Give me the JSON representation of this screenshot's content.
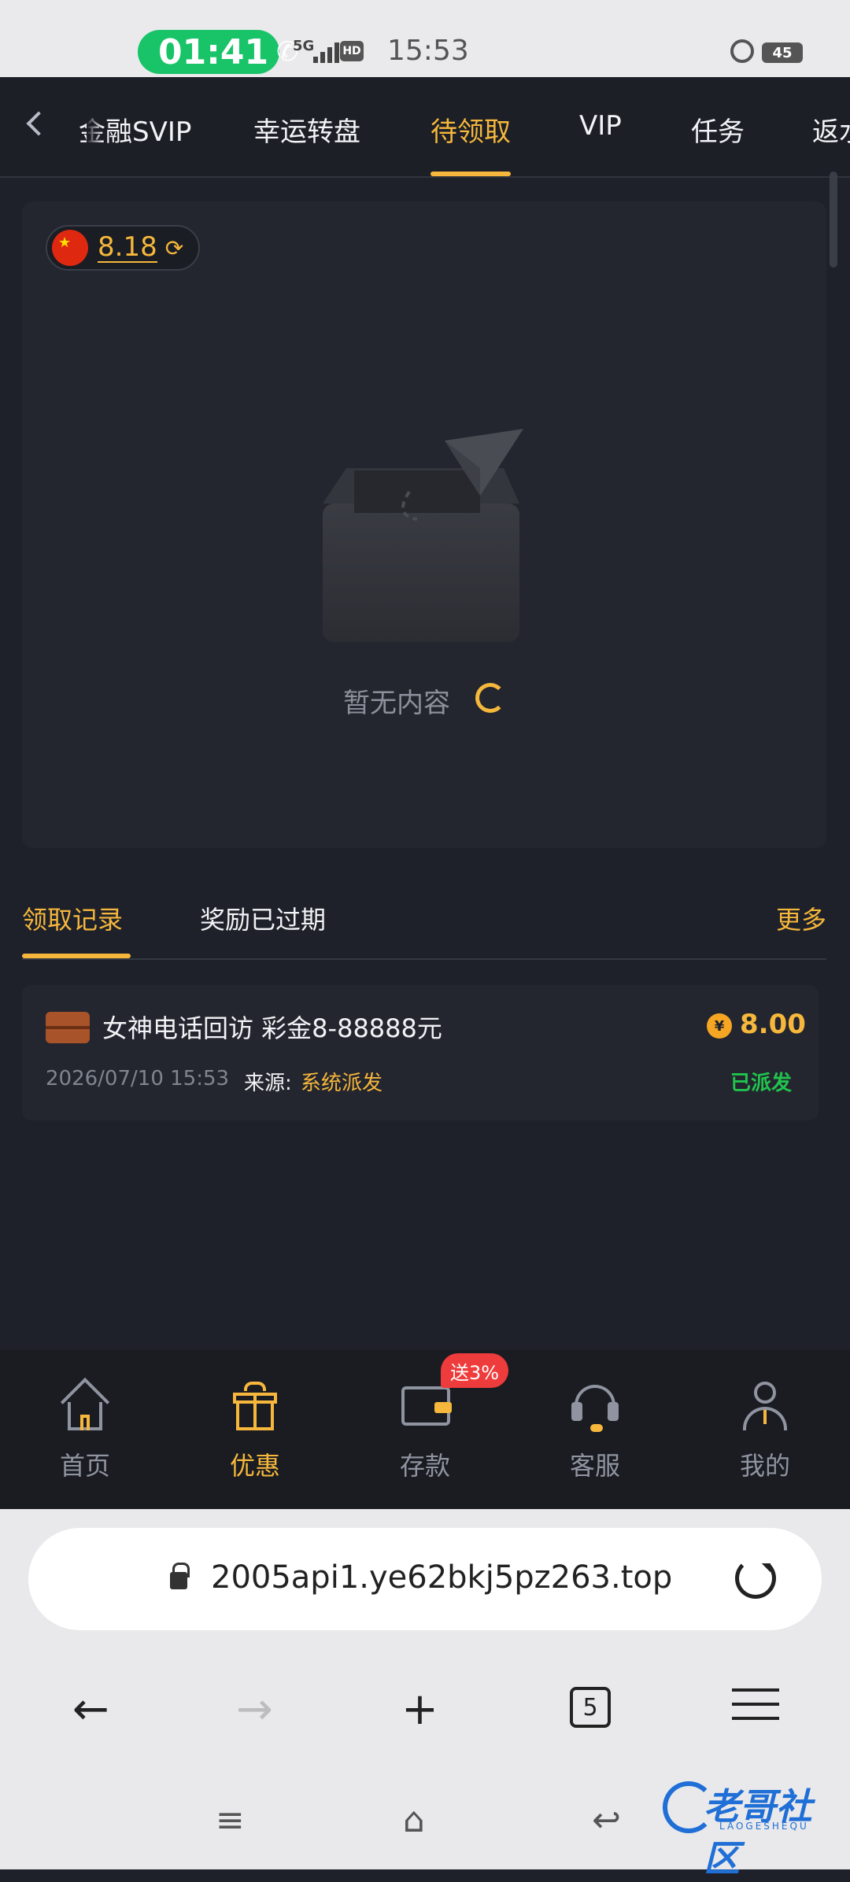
{
  "status_bar": {
    "call_timer": "01:41",
    "network": "5G",
    "hd": "HD",
    "time": "15:53",
    "battery": "45"
  },
  "top_tabs": {
    "items": [
      {
        "label": "金融SVIP"
      },
      {
        "label": "幸运转盘"
      },
      {
        "label": "待领取"
      },
      {
        "label": "VIP"
      },
      {
        "label": "任务"
      },
      {
        "label": "返水"
      }
    ],
    "active_index": 2
  },
  "balance": {
    "value": "8.18"
  },
  "empty_state": {
    "text": "暂无内容"
  },
  "records_tabs": {
    "tab1": "领取记录",
    "tab2": "奖励已过期",
    "more": "更多"
  },
  "record": {
    "title": "女神电话回访 彩金8-88888元",
    "currency_symbol": "¥",
    "amount": "8.00",
    "date": "2026/07/10 15:53",
    "source_label": "来源:",
    "source": "系统派发",
    "status": "已派发"
  },
  "bottom_nav": {
    "items": [
      {
        "label": "首页",
        "icon": "home-icon"
      },
      {
        "label": "优惠",
        "icon": "gift-icon"
      },
      {
        "label": "存款",
        "icon": "wallet-icon"
      },
      {
        "label": "客服",
        "icon": "headset-icon"
      },
      {
        "label": "我的",
        "icon": "user-icon"
      }
    ],
    "active_index": 1,
    "deposit_badge": "送3%"
  },
  "browser": {
    "url": "2005api1.ye62bkj5pz263.top",
    "tab_count": "5"
  },
  "watermark": {
    "text": "老哥社区",
    "sub": "LAOGESHEQU"
  },
  "colors": {
    "accent": "#f6b73c",
    "background": "#1e2129",
    "success": "#21c34d",
    "badge": "#ee3b3b"
  }
}
